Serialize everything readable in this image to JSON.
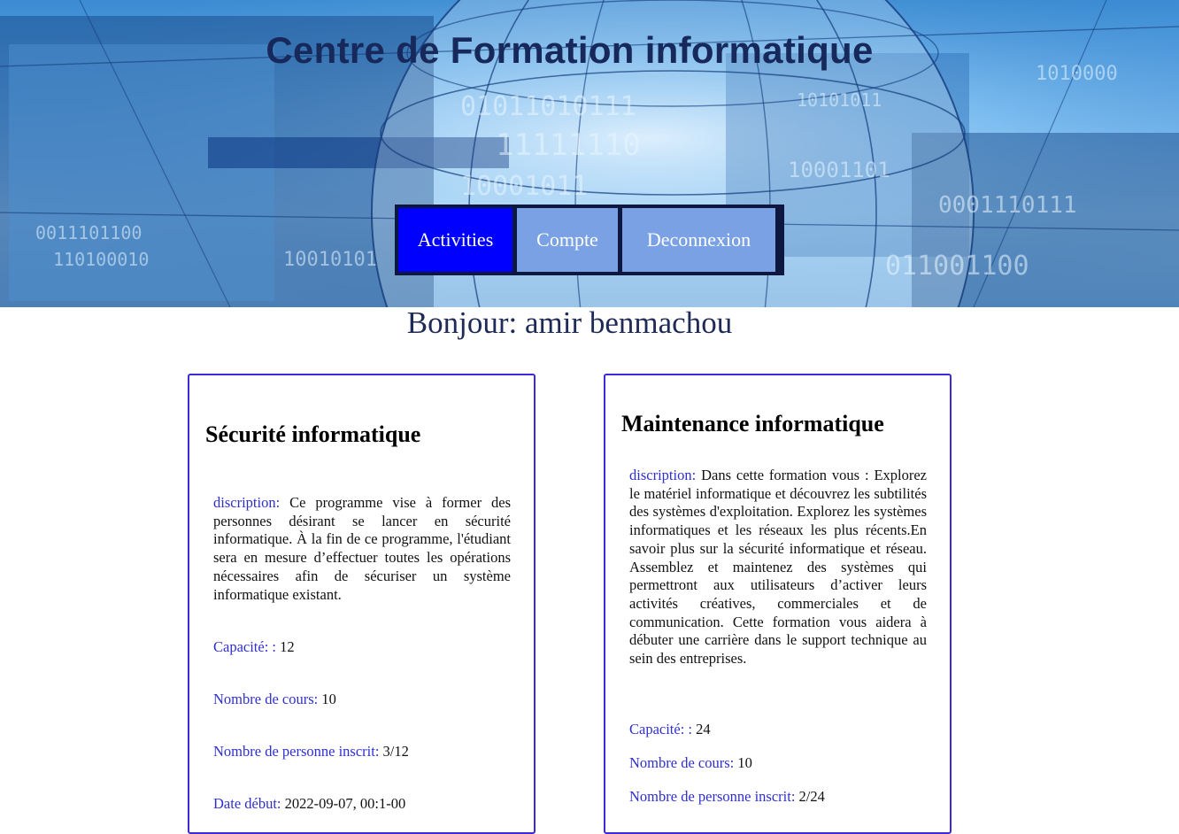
{
  "header": {
    "title": "Centre de Formation informatique"
  },
  "nav": {
    "items": [
      {
        "label": "Activities",
        "active": true
      },
      {
        "label": "Compte",
        "active": false
      },
      {
        "label": "Deconnexion",
        "active": false
      }
    ]
  },
  "greeting": "Bonjour: amir benmachou",
  "labels": {
    "description": "discription:",
    "capacity": "Capacité: :",
    "courses": "Nombre de cours:",
    "enrolled": "Nombre de personne inscrit:",
    "start": "Date début:"
  },
  "formations": [
    {
      "title": "Sécurité informatique",
      "description": "Ce programme vise à former des personnes désirant se lancer en sécurité informatique. À la fin de ce programme, l'étudiant sera en mesure d’effectuer toutes les opérations nécessaires afin de sécuriser un système informatique existant.",
      "capacity": "12",
      "courses": "10",
      "enrolled": "3/12",
      "start": "2022-09-07, 00:1-00"
    },
    {
      "title": "Maintenance informatique",
      "description": "Dans cette formation vous : Explorez le matériel informatique et découvrez les subtilités des systèmes d'exploitation. Explorez les systèmes informatiques et les réseaux les plus récents.En savoir plus sur la sécurité informatique et réseau. Assemblez et maintenez des systèmes qui permettront aux utilisateurs d’activer leurs activités créatives, commerciales et de communication. Cette formation vous aidera à débuter une carrière dans le support technique au sein des entreprises.",
      "capacity": "24",
      "courses": "10",
      "enrolled": "2/24"
    }
  ],
  "colors": {
    "nav_active": "#0000ff",
    "nav_inactive": "#7aa1e3",
    "nav_border": "#0d1740",
    "card_border": "#3b2ad6",
    "label": "#2f2fd0",
    "title": "#16295a"
  }
}
